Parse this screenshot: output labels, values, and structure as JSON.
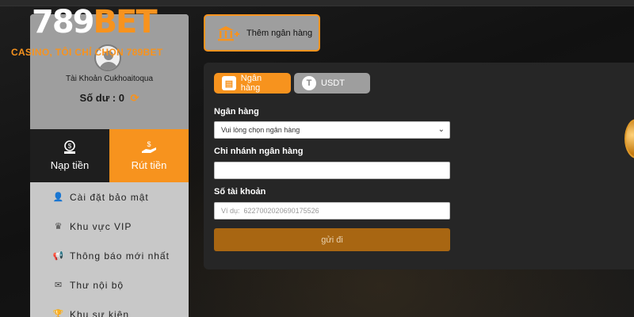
{
  "brand": {
    "logo_number": "789",
    "logo_bet": "BET",
    "slogan": "CASINO, TÔI CHỈ CHỌN 789BET"
  },
  "account": {
    "name": "Tài Khoản Cukhoaitoqua",
    "balance_label": "Số dư :",
    "balance_value": "0"
  },
  "actions": {
    "deposit": "Nạp tiền",
    "withdraw": "Rút tiền"
  },
  "menu": [
    {
      "label": "Cài đặt bảo mật",
      "icon": "user-shield-icon"
    },
    {
      "label": "Khu vực VIP",
      "icon": "vip-icon"
    },
    {
      "label": "Thông báo mới nhất",
      "icon": "megaphone-icon"
    },
    {
      "label": "Thư nội bộ",
      "icon": "envelope-icon"
    },
    {
      "label": "Khu sự kiện",
      "icon": "trophy-icon"
    }
  ],
  "add_bank": {
    "label": "Thêm ngân hàng"
  },
  "tabs": [
    {
      "label": "Ngân hàng",
      "active": true
    },
    {
      "label": "USDT",
      "active": false
    }
  ],
  "form": {
    "bank_label": "Ngân hàng",
    "bank_select_value": "Vui lòng chọn ngân hàng",
    "branch_label": "Chi nhánh ngân hàng",
    "branch_value": "",
    "account_label": "Số tài khoản",
    "account_placeholder": "Ví dụ:  6227002020690175526",
    "submit_label": "gửi đi"
  },
  "colors": {
    "accent": "#f7931e",
    "panel": "#262626",
    "sidebar": "#c8c8c8",
    "submit": "#a86612"
  }
}
